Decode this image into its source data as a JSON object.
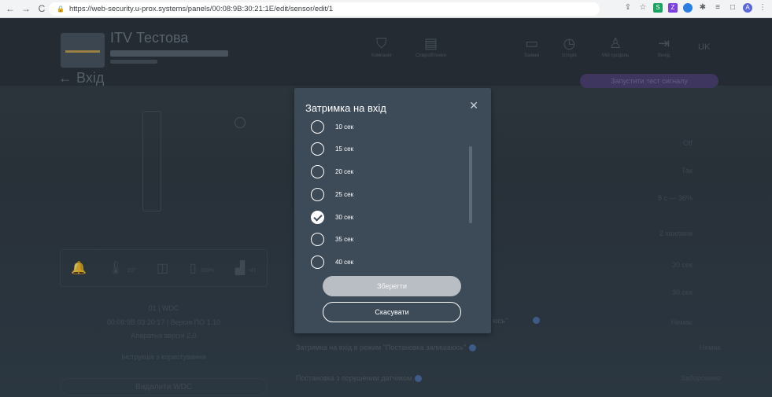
{
  "browser": {
    "url": "https://web-security.u-prox.systems/panels/00:08:9B:30:21:1E/edit/sensor/edit/1"
  },
  "header": {
    "object_title": "ITV Тестова",
    "nav": [
      {
        "label": "Компанія",
        "icon": "shield-icon"
      },
      {
        "label": "Співробітники",
        "icon": "id-card-icon"
      },
      {
        "label": "Заявки",
        "icon": "clipboard-icon"
      },
      {
        "label": "Історія",
        "icon": "history-icon"
      },
      {
        "label": "Мій профіль",
        "icon": "user-icon"
      },
      {
        "label": "Вихід",
        "icon": "logout-icon"
      }
    ],
    "lang": "UK"
  },
  "page": {
    "title": "Вхід",
    "test_button": "Запустити тест сигналу"
  },
  "left": {
    "stats": [
      "20°",
      "100%",
      "-41"
    ],
    "device_name": "01 | WDC",
    "device_info": "00:08:9B:03:20:17 | Версія ПО 1.10",
    "hw_version": "Апаратна версія 2.0",
    "instruction": "Інструкція з користування",
    "delete_button": "Видалити WDC"
  },
  "right": {
    "values": [
      "Off",
      "Так",
      "8 с — 36%",
      "2 хвилини",
      "30 сек",
      "30 сек",
      "Немає",
      "Немає",
      "Заборонено"
    ],
    "rows": [
      {
        "label": "Затримка на вхід в режим \"Постановка залишаюсь\"",
        "value": "Немає"
      },
      {
        "label": "Постановка з порушеним датчиком",
        "value": "Заборонено"
      }
    ],
    "partial_label": "юсь\""
  },
  "modal": {
    "title": "Затримка на вхід",
    "options": [
      {
        "label": "10 сек",
        "checked": false
      },
      {
        "label": "15 сек",
        "checked": false
      },
      {
        "label": "20 сек",
        "checked": false
      },
      {
        "label": "25 сек",
        "checked": false
      },
      {
        "label": "30 сек",
        "checked": true
      },
      {
        "label": "35 сек",
        "checked": false
      },
      {
        "label": "40 сек",
        "checked": false
      }
    ],
    "save_label": "Зберегти",
    "cancel_label": "Скасувати"
  }
}
